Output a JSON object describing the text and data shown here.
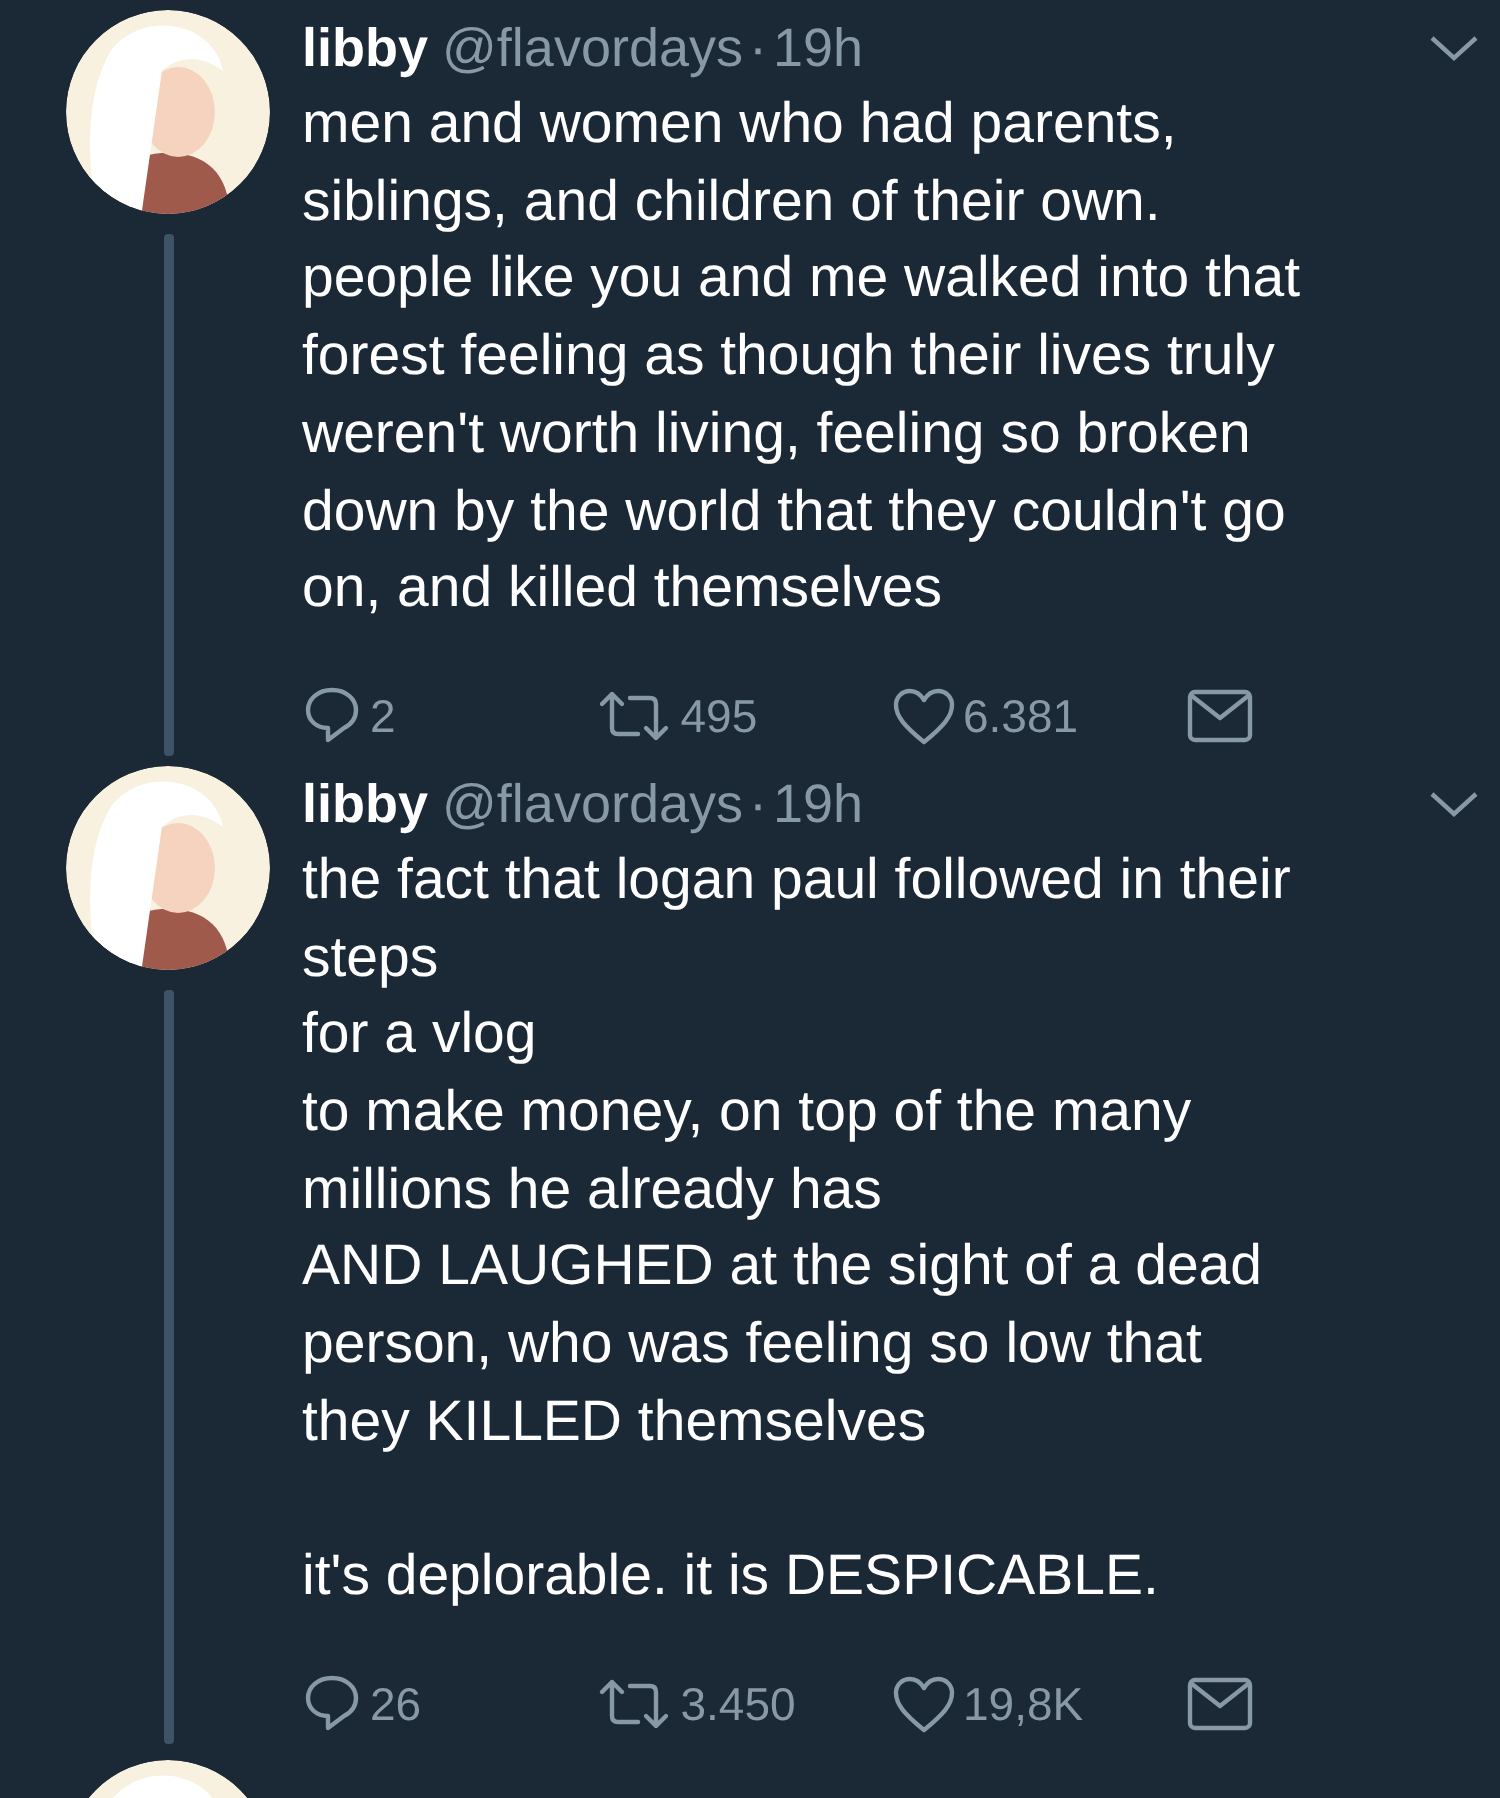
{
  "tweets": [
    {
      "name": "libby",
      "handle": "@flavordays",
      "dot": "·",
      "time": "19h",
      "text": "men and women who had parents,\nsiblings, and children of their own.\npeople like you and me walked into that\nforest feeling as though their lives truly\nweren't worth living, feeling so broken\ndown by the world that they couldn't go\non, and killed themselves",
      "replies": "2",
      "retweets": "495",
      "likes": "6.381",
      "thread": true
    },
    {
      "name": "libby",
      "handle": "@flavordays",
      "dot": "·",
      "time": "19h",
      "text": "the fact that logan paul followed in their\nsteps\nfor a vlog\nto make money, on top of the many\nmillions he already has\nAND LAUGHED at the sight of a dead\nperson, who was feeling so low that\nthey KILLED themselves\n\nit's deplorable. it is DESPICABLE.",
      "replies": "26",
      "retweets": "3.450",
      "likes": "19,8K",
      "thread": true
    }
  ]
}
